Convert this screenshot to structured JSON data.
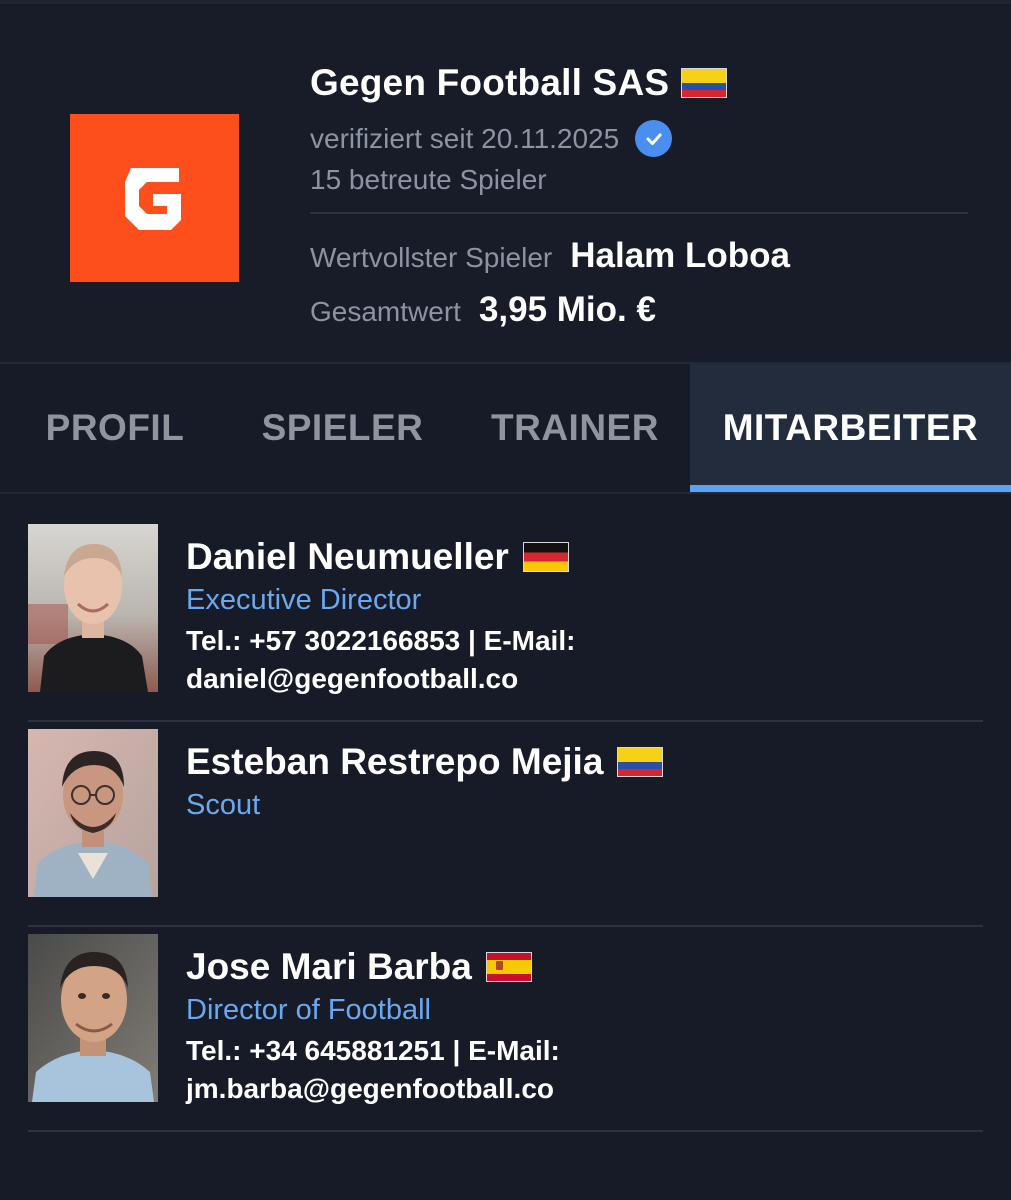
{
  "header": {
    "agency_name": "Gegen Football SAS",
    "country_flag": "flag-colombia",
    "verified_text": "verifiziert seit 20.11.2025",
    "players_count_text": "15 betreute Spieler",
    "mvp_label": "Wertvollster Spieler",
    "mvp_value": "Halam Loboa",
    "total_label": "Gesamtwert",
    "total_value": "3,95 Mio. €",
    "logo_icon": "gegen-g-logo",
    "logo_color": "#fd4f1c",
    "verified_icon": "verified-check-icon",
    "verified_color": "#4a8ff0"
  },
  "tabs": [
    {
      "label": "PROFIL",
      "active": false
    },
    {
      "label": "SPIELER",
      "active": false
    },
    {
      "label": "TRAINER",
      "active": false
    },
    {
      "label": "MITARBEITER",
      "active": true
    }
  ],
  "staff": [
    {
      "name": "Daniel Neumueller",
      "flag": "flag-germany",
      "role": "Executive Director",
      "contact_line1": "Tel.: +57 3022166853 | E-Mail:",
      "contact_line2": "daniel@gegenfootball.co"
    },
    {
      "name": "Esteban Restrepo Mejia",
      "flag": "flag-colombia",
      "role": "Scout"
    },
    {
      "name": "Jose Mari Barba",
      "flag": "flag-spain",
      "role": "Director of Football",
      "contact_line1": "Tel.: +34 645881251 | E-Mail:",
      "contact_line2": "jm.barba@gegenfootball.co"
    }
  ],
  "colors": {
    "background": "#161b27",
    "accent": "#5aa3f2",
    "role_text": "#6aa8ef",
    "active_tab_bg": "#232c3d"
  }
}
